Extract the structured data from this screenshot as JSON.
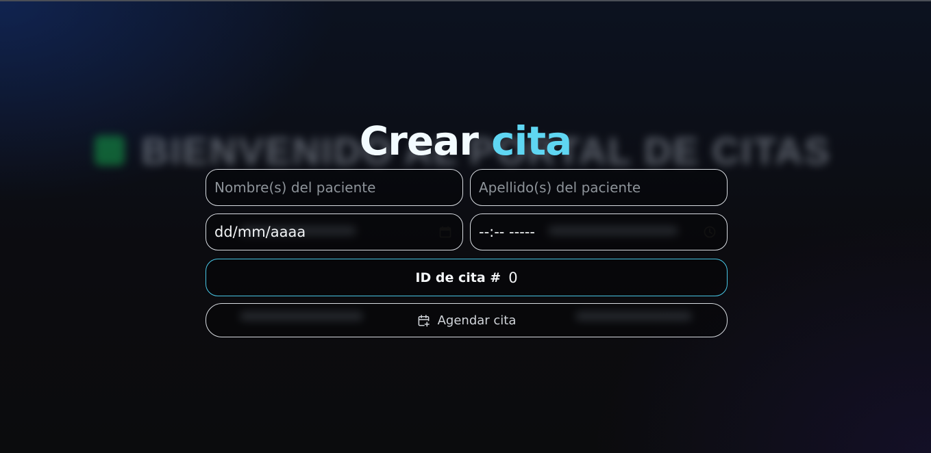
{
  "background": {
    "title": "BIENVENIDO AL PORTAL DE CITAS",
    "accent_color": "#15a04a"
  },
  "form": {
    "title_part1": "Crear",
    "title_part2": "cita",
    "title_accent_color": "#5fd6f2",
    "first_name_placeholder": "Nombre(s) del paciente",
    "last_name_placeholder": "Apellido(s) del paciente",
    "date_display": "dd/mm/aaaa",
    "time_display": "--:-- -----",
    "id_label": "ID de cita #",
    "id_value": "0",
    "id_border_color": "#48c7e6",
    "submit_label": "Agendar cita",
    "date_icon": "calendar-icon",
    "time_icon": "clock-icon",
    "submit_icon": "calendar-plus-icon"
  }
}
